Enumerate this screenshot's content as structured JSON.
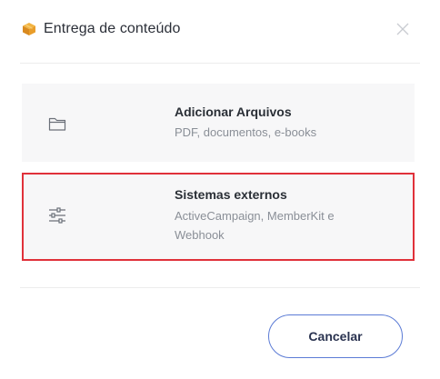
{
  "header": {
    "title": "Entrega de conteúdo",
    "title_icon": "package-box-icon",
    "close_icon": "close-icon"
  },
  "options": [
    {
      "title": "Adicionar Arquivos",
      "description": "PDF, documentos, e-books",
      "icon": "folder-icon",
      "selected": false
    },
    {
      "title": "Sistemas externos",
      "description": "ActiveCampaign, MemberKit e Webhook",
      "icon": "sliders-icon",
      "selected": true
    }
  ],
  "footer": {
    "cancel_label": "Cancelar"
  },
  "colors": {
    "selected_border": "#e0313a",
    "button_border": "#5b7bd5",
    "card_background": "#f7f7f8"
  }
}
